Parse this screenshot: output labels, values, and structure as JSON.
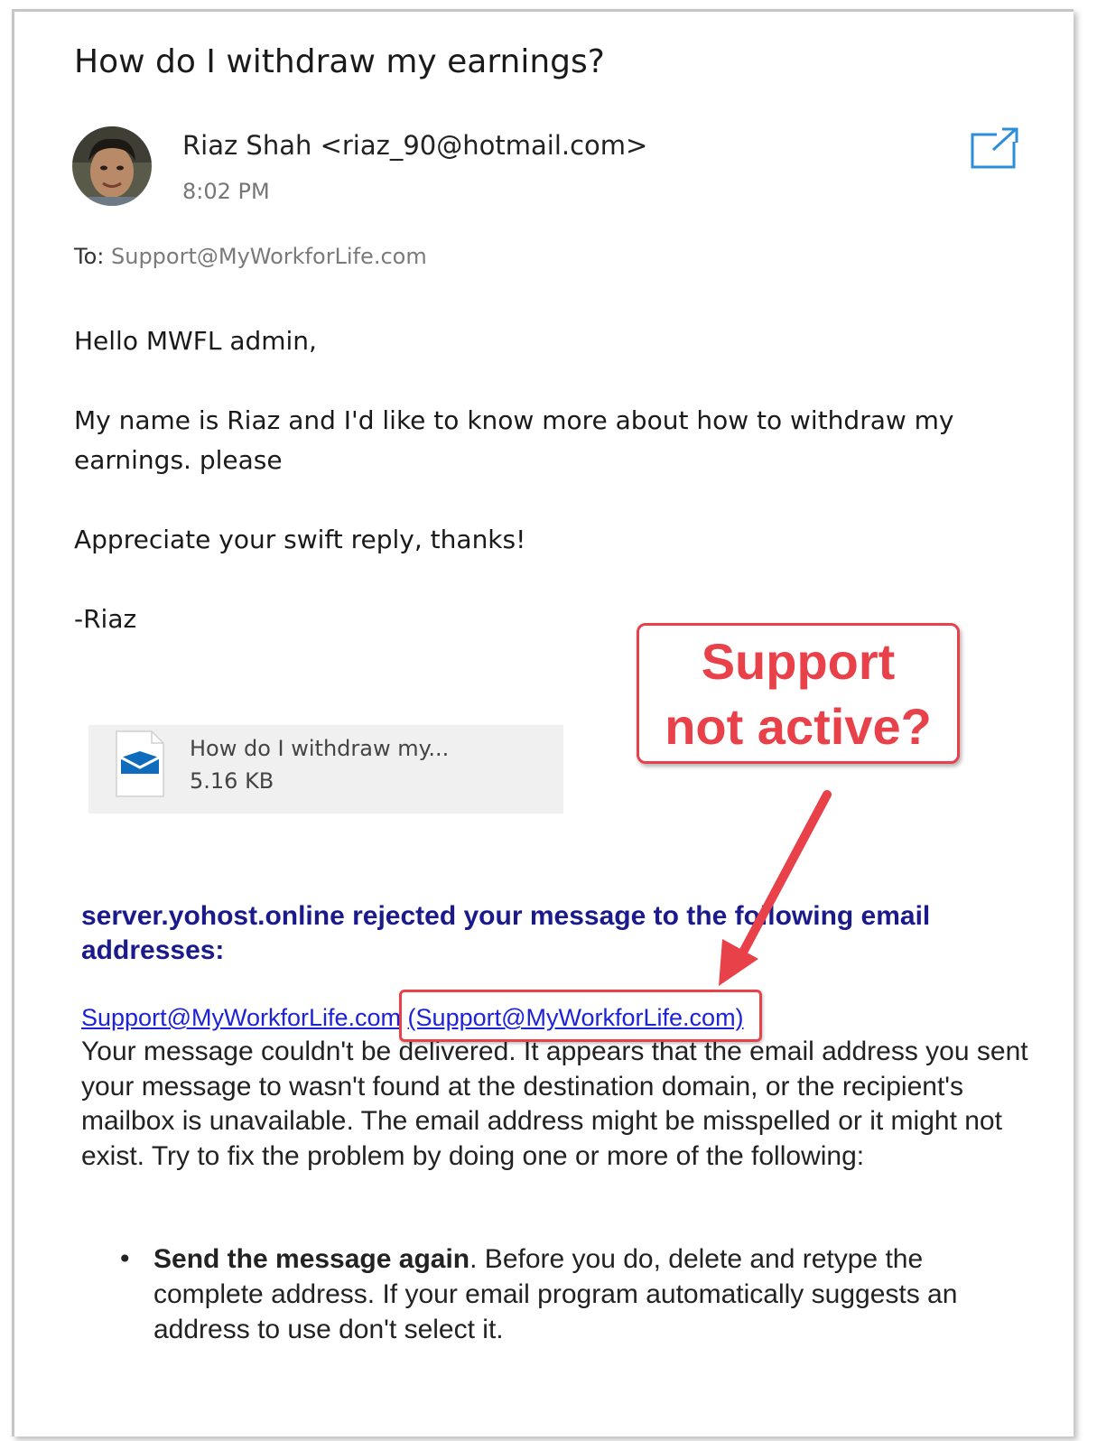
{
  "email": {
    "subject": "How do I withdraw my earnings?",
    "sender": "Riaz Shah <riaz_90@hotmail.com>",
    "time": "8:02 PM",
    "to_label": "To:",
    "to_address": "Support@MyWorkforLife.com",
    "body": {
      "greeting": "Hello MWFL admin,",
      "paragraph1": "My name is Riaz and I'd like to know more about how to withdraw my earnings. please",
      "paragraph2": "Appreciate your swift reply, thanks!",
      "signoff": "-Riaz"
    },
    "attachment": {
      "name": "How do I withdraw my...",
      "size": "5.16 KB",
      "icon": "mail-envelope-icon"
    },
    "popout_icon": "popout-icon"
  },
  "bounce": {
    "heading": "server.yohost.online rejected your message to the following email addresses:",
    "link1": "Support@MyWorkforLife.com",
    "link2": "(Support@MyWorkforLife.com)",
    "body": "Your message couldn't be delivered. It appears that the email address you sent your message to wasn't found at the destination domain, or the recipient's mailbox is unavailable. The email address might be misspelled or it might not exist. Try to fix the problem by doing one or more of the following:",
    "bullet_bold": "Send the message again",
    "bullet_rest": ". Before you do, delete and retype the complete address. If your email program automatically suggests an address to use don't select it."
  },
  "annotation": {
    "line1": "Support",
    "line2": "not active?",
    "color": "#e8414a"
  }
}
